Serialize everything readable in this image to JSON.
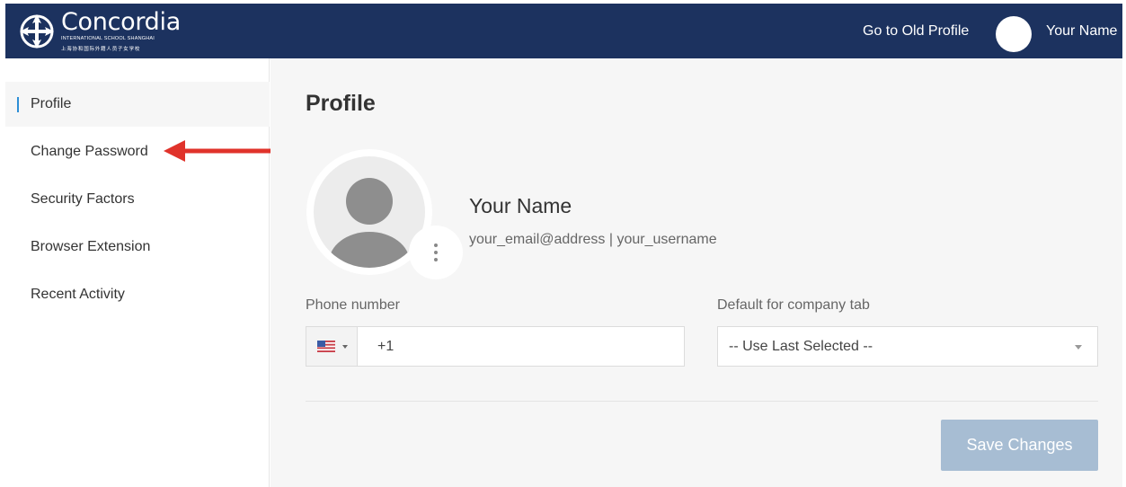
{
  "header": {
    "logo_title": "Concordia",
    "logo_subtitle": "INTERNATIONAL SCHOOL SHANGHAI",
    "logo_chinese": "上海协和国际外籍人员子女学校",
    "old_profile_link": "Go to Old Profile",
    "user_name": "Your Name"
  },
  "sidebar": {
    "items": [
      {
        "label": "Profile",
        "active": true
      },
      {
        "label": "Change Password"
      },
      {
        "label": "Security Factors"
      },
      {
        "label": "Browser Extension"
      },
      {
        "label": "Recent Activity"
      }
    ]
  },
  "main": {
    "title": "Profile",
    "user_name": "Your Name",
    "user_details": "your_email@address | your_username",
    "phone": {
      "label": "Phone number",
      "country": "US",
      "value": "+1"
    },
    "company_tab": {
      "label": "Default for company tab",
      "selected": "-- Use Last Selected --"
    },
    "save_label": "Save Changes"
  },
  "colors": {
    "header_bg": "#1c325f",
    "accent": "#2d8fd6",
    "save_disabled": "#a7bdd3",
    "annotation_arrow": "#e0332b"
  }
}
